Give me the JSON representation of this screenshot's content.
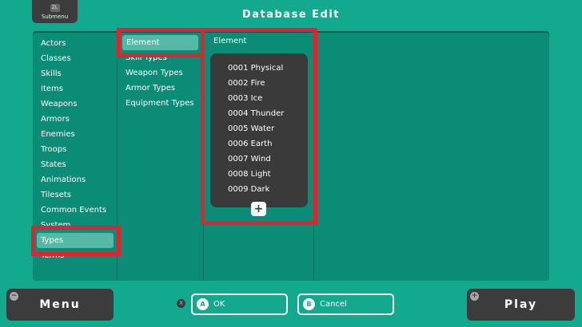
{
  "header": {
    "submenu_badge": "ZL",
    "submenu_label": "Submenu",
    "title": "Database Edit"
  },
  "categories": [
    "Actors",
    "Classes",
    "Skills",
    "Items",
    "Weapons",
    "Armors",
    "Enemies",
    "Troops",
    "States",
    "Animations",
    "Tilesets",
    "Common Events",
    "System"
  ],
  "categories_after": [
    "Terms"
  ],
  "selected_category": "Types",
  "type_selected": "Element",
  "types": [
    "Skill Types",
    "Weapon Types",
    "Armor Types",
    "Equipment Types"
  ],
  "column3_header": "Element",
  "elements": [
    "0001 Physical",
    "0002 Fire",
    "0003 Ice",
    "0004 Thunder",
    "0005 Water",
    "0006 Earth",
    "0007 Wind",
    "0008 Light",
    "0009 Dark"
  ],
  "add_symbol": "+",
  "footer": {
    "menu_label": "Menu",
    "menu_badge": "−",
    "x_badge": "X",
    "ok_badge": "A",
    "ok_label": "OK",
    "cancel_badge": "B",
    "cancel_label": "Cancel",
    "play_label": "Play",
    "play_badge": "+"
  },
  "colors": {
    "background": "#13a98f",
    "panel": "#0b8c76",
    "selection": "#55b9a6",
    "dark": "#3c3c3c",
    "highlight_box": "#e0232e"
  }
}
